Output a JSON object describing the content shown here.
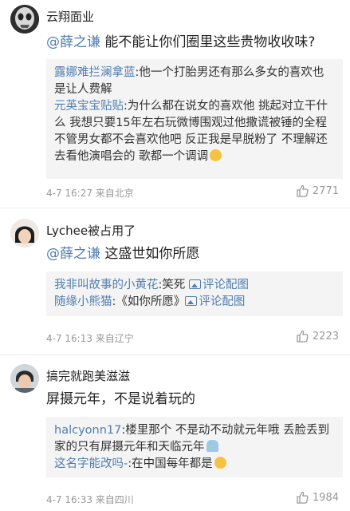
{
  "comments": [
    {
      "username": "云翔面业",
      "mention": "@薛之谦",
      "text": " 能不能让你们圈里这些贵物收收味?",
      "replies": [
        {
          "user": "露娜难拦澜拿蓝",
          "text": ":他一个打胎男还有那么多女的喜欢也是让人费解"
        },
        {
          "user": "元英宝宝贴贴",
          "text": ":为什么都在说女的喜欢他 挑起对立干什么 我想只要15年左右玩微博围观过他撒谎被锤的全程 不管男女都不会喜欢他吧 反正我是早脱粉了 不理解还去看他演唱会的 歌都一个调调"
        }
      ],
      "meta": "4-7 16:27 来自北京",
      "likes": "2771"
    },
    {
      "username": "Lychee被占用了",
      "mention": "@薛之谦",
      "text": " 这盛世如你所愿",
      "replies": [
        {
          "user": "我非叫故事的小黄花",
          "text": ":笑死 ",
          "link": "评论配图"
        },
        {
          "user": "随缘小熊猫",
          "text": ":《如你所愿》",
          "link": "评论配图"
        }
      ],
      "meta": "4-7 16:13 来自辽宁",
      "likes": "2223"
    },
    {
      "username": "搞完就跑美滋滋",
      "text": "屏摄元年，不是说着玩的",
      "replies": [
        {
          "user": "halcyonn17",
          "text": ":楼里那个 不是动不动就元年哦 丢脸丢到家的只有屏摄元年和天临元年"
        },
        {
          "user": "这名字能改吗-",
          "text": ":在中国每年都是"
        }
      ],
      "meta": "4-7 16:33 来自四川",
      "likes": "1984"
    }
  ],
  "colors": {
    "link": "#507daf",
    "reply_bg": "#f4f4f4",
    "meta": "#999999"
  }
}
